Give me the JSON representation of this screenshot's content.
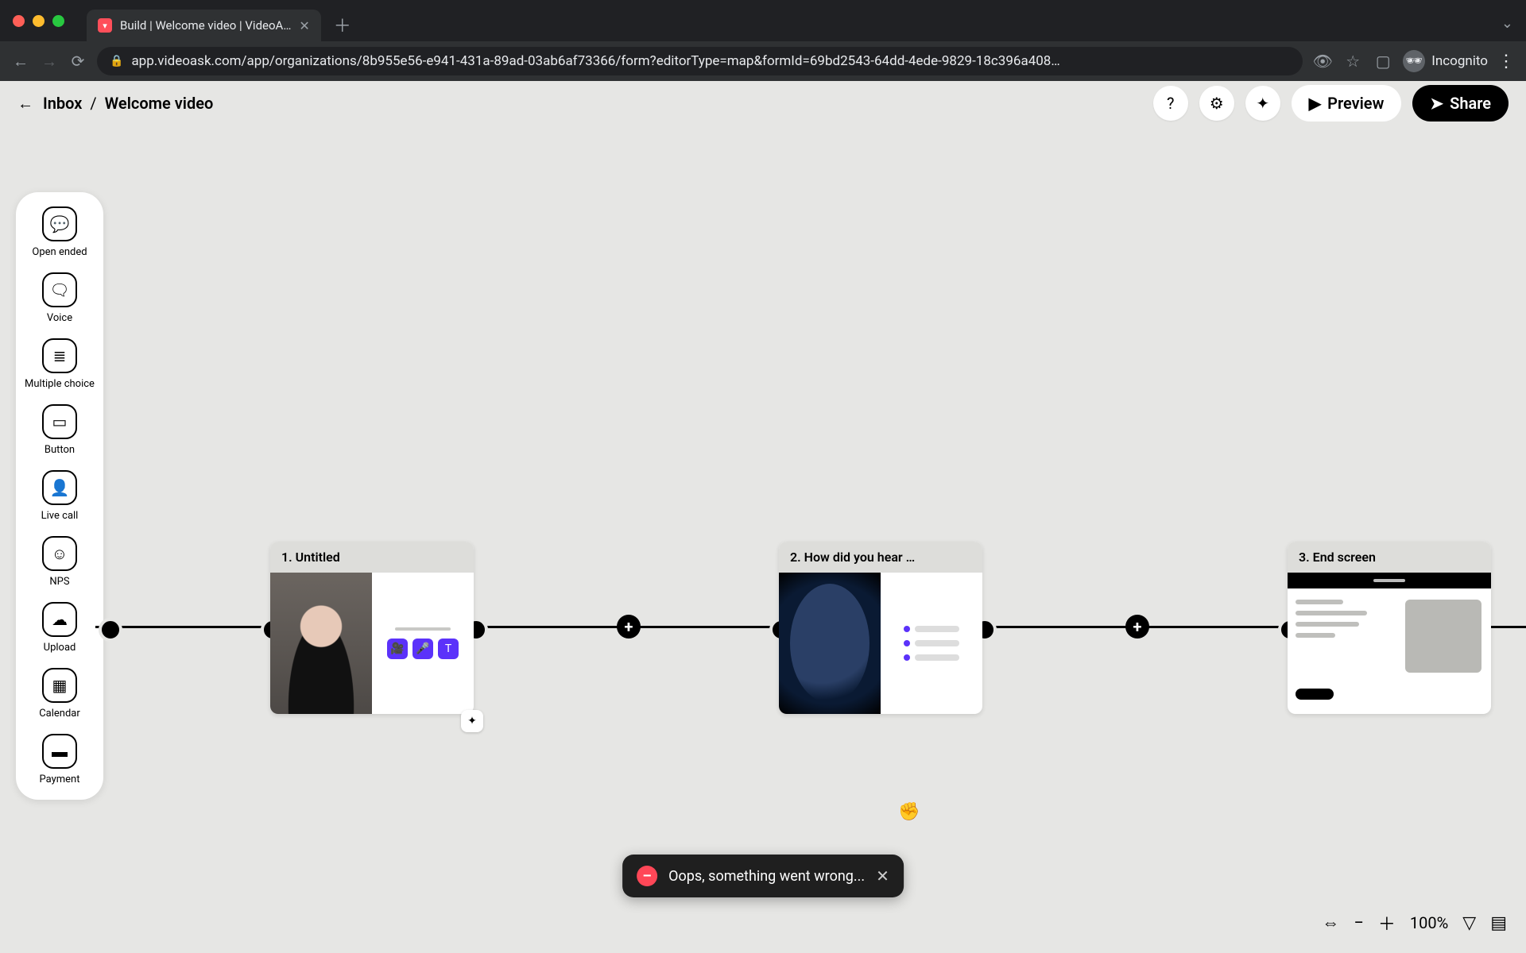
{
  "browser": {
    "tab_title": "Build | Welcome video | VideoA…",
    "url": "app.videoask.com/app/organizations/8b955e56-e941-431a-89ad-03ab6af73366/form?editorType=map&formId=69bd2543-64dd-4ede-9829-18c396a408…",
    "mode": "Incognito"
  },
  "header": {
    "back_label": "Inbox",
    "separator": "/",
    "title": "Welcome video",
    "preview": "Preview",
    "share": "Share"
  },
  "palette": [
    {
      "id": "open-ended",
      "label": "Open ended"
    },
    {
      "id": "voice",
      "label": "Voice"
    },
    {
      "id": "multiple-choice",
      "label": "Multiple choice"
    },
    {
      "id": "button",
      "label": "Button"
    },
    {
      "id": "live-call",
      "label": "Live call"
    },
    {
      "id": "nps",
      "label": "NPS"
    },
    {
      "id": "upload",
      "label": "Upload"
    },
    {
      "id": "calendar",
      "label": "Calendar"
    },
    {
      "id": "payment",
      "label": "Payment"
    }
  ],
  "nodes": {
    "n1": {
      "title": "1. Untitled"
    },
    "n2": {
      "title": "2. How did you hear …"
    },
    "n3": {
      "title": "3. End screen"
    }
  },
  "toast": {
    "message": "Oops, something went wrong..."
  },
  "zoom": {
    "value": "100%"
  }
}
